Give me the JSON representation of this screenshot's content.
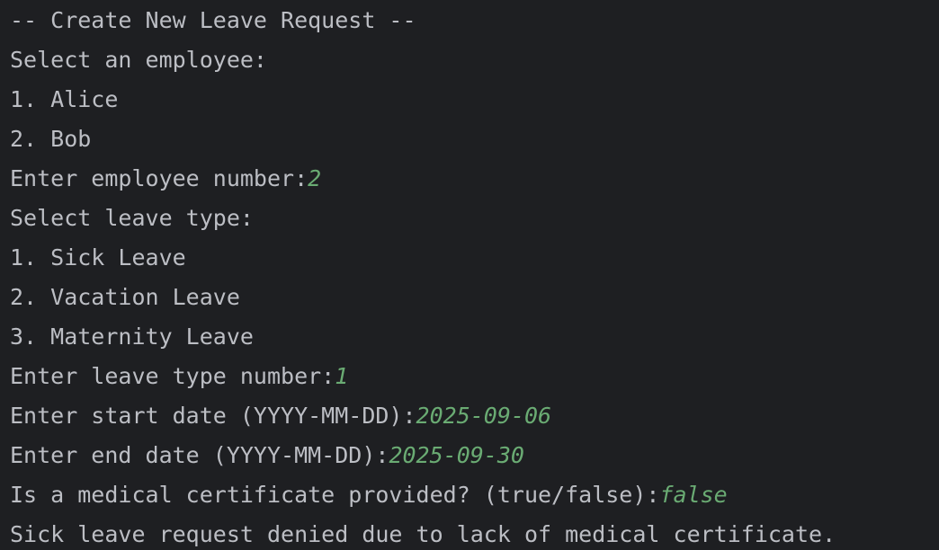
{
  "console": {
    "header": "-- Create New Leave Request --",
    "employee_prompt": "Select an employee:",
    "employees": [
      "1. Alice",
      "2. Bob"
    ],
    "employee_number_prompt": "Enter employee number:",
    "employee_number_input": "2",
    "leave_type_prompt": "Select leave type:",
    "leave_types": [
      "1. Sick Leave",
      "2. Vacation Leave",
      "3. Maternity Leave"
    ],
    "leave_type_number_prompt": "Enter leave type number:",
    "leave_type_number_input": "1",
    "start_date_prompt": "Enter start date (YYYY-MM-DD):",
    "start_date_input": "2025-09-06",
    "end_date_prompt": "Enter end date (YYYY-MM-DD):",
    "end_date_input": "2025-09-30",
    "certificate_prompt": "Is a medical certificate provided? (true/false):",
    "certificate_input": "false",
    "result_message": "Sick leave request denied due to lack of medical certificate."
  },
  "colors": {
    "background": "#1e1f22",
    "output_text": "#bcbec4",
    "user_input": "#6aab73"
  }
}
